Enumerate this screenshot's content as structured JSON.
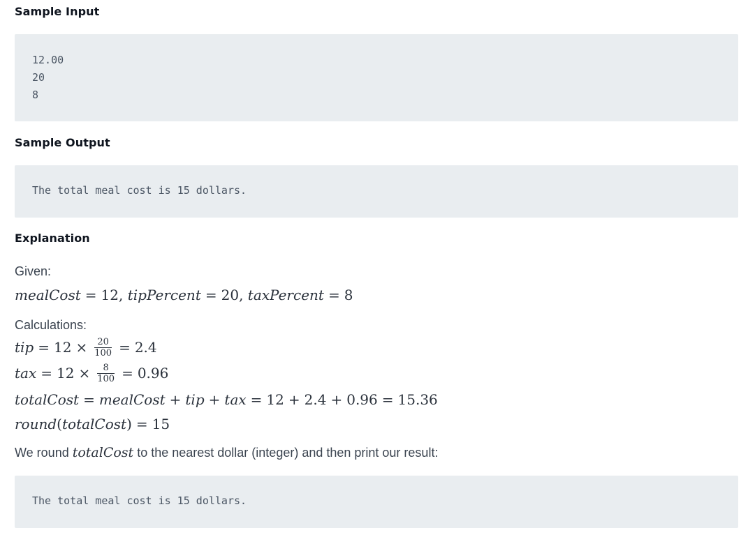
{
  "sample_input": {
    "heading": "Sample Input",
    "lines": [
      "12.00",
      "20",
      "8"
    ]
  },
  "sample_output": {
    "heading": "Sample Output",
    "text": "The total meal cost is 15 dollars."
  },
  "explanation": {
    "heading": "Explanation",
    "given_label": "Given:",
    "given": {
      "meal_var": "mealCost",
      "meal_val": "12",
      "tip_var": "tipPercent",
      "tip_val": "20",
      "tax_var": "taxPercent",
      "tax_val": "8"
    },
    "calculations_label": "Calculations:",
    "tip": {
      "var": "tip",
      "base": "12",
      "num": "20",
      "den": "100",
      "result": "2.4"
    },
    "tax": {
      "var": "tax",
      "base": "12",
      "num": "8",
      "den": "100",
      "result": "0.96"
    },
    "total": {
      "var": "totalCost",
      "a": "mealCost",
      "b": "tip",
      "c": "tax",
      "v1": "12",
      "v2": "2.4",
      "v3": "0.96",
      "result": "15.36"
    },
    "round": {
      "fn": "round",
      "arg": "totalCost",
      "result": "15"
    },
    "note_prefix": "We round ",
    "note_var": "totalCost",
    "note_suffix": " to the nearest dollar (integer) and then print our result:",
    "final_output": "The total meal cost is 15 dollars."
  }
}
